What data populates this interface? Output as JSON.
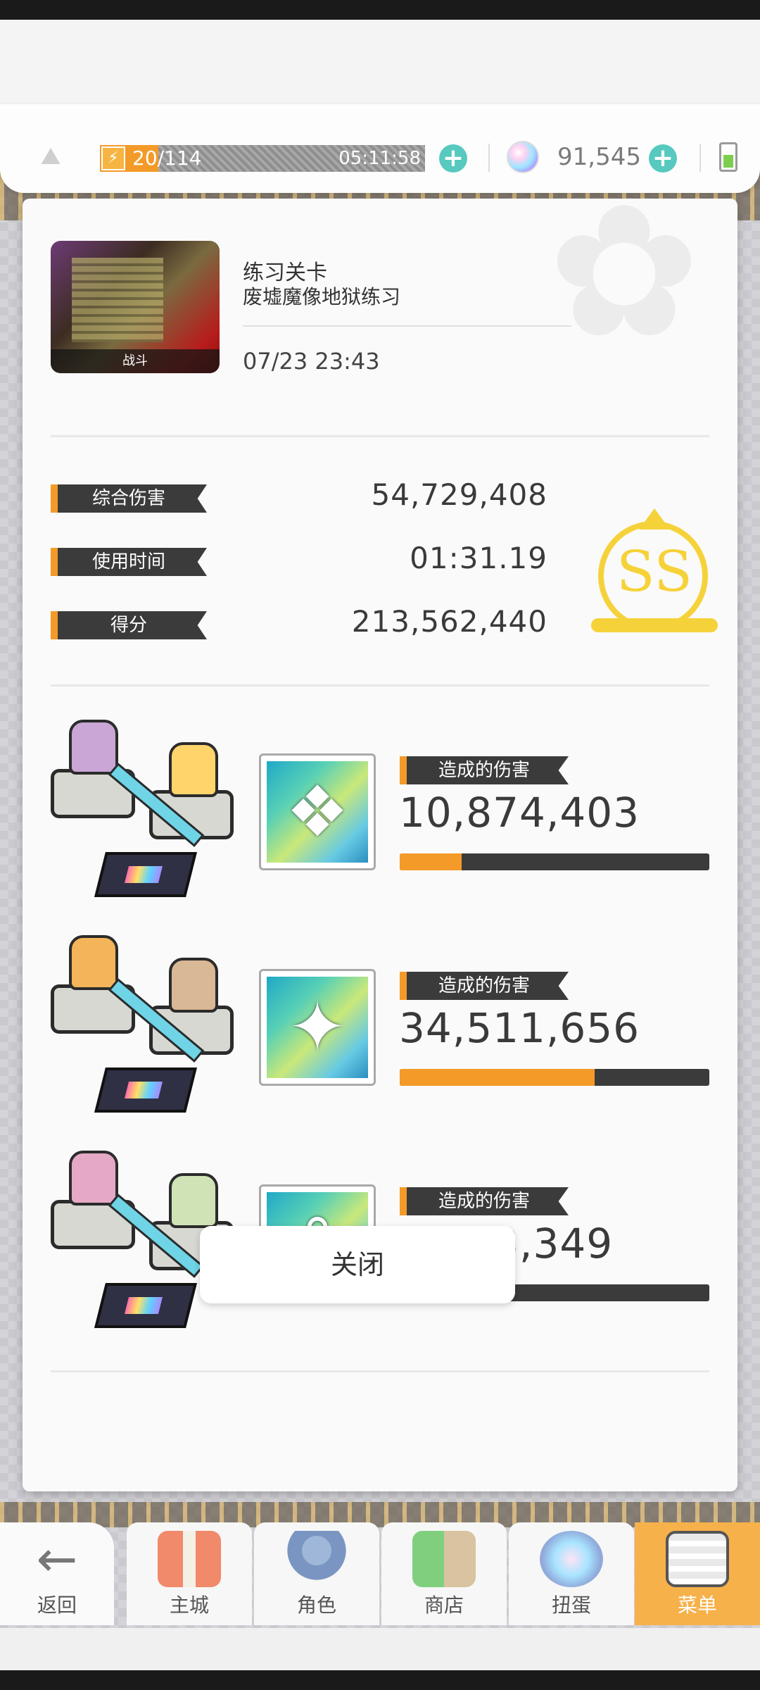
{
  "status_bar": {
    "energy_text": "20/114",
    "energy_timer": "05:11:58",
    "energy_fraction": 0.18,
    "gems": "91,545"
  },
  "result": {
    "thumbnail_label": "战斗",
    "stage_type": "练习关卡",
    "stage_name": "废墟魔像地狱练习",
    "datetime": "07/23 23:43",
    "stats": [
      {
        "label": "综合伤害",
        "value": "54,729,408"
      },
      {
        "label": "使用时间",
        "value": "01:31.19"
      },
      {
        "label": "得分",
        "value": "213,562,440"
      }
    ],
    "rank": "SS",
    "party": [
      {
        "damage_label": "造成的伤害",
        "damage": "10,874,403",
        "share": 0.2,
        "weapon_icon": "staff-icon"
      },
      {
        "damage_label": "造成的伤害",
        "damage": "34,511,656",
        "share": 0.63,
        "weapon_icon": "mace-icon"
      },
      {
        "damage_label": "造成的伤害",
        "damage": "9,343,349",
        "share": 0.17,
        "weapon_icon": "bow-icon"
      }
    ],
    "close_label": "关闭"
  },
  "nav": {
    "items": [
      {
        "label": "返回",
        "icon": "back-arrow-icon"
      },
      {
        "label": "主城",
        "icon": "castle-icon"
      },
      {
        "label": "角色",
        "icon": "character-icon"
      },
      {
        "label": "商店",
        "icon": "shop-icon"
      },
      {
        "label": "扭蛋",
        "icon": "gacha-icon"
      },
      {
        "label": "菜单",
        "icon": "menu-icon"
      }
    ]
  },
  "colors": {
    "accent": "#f39a28",
    "rank": "#f6d23a",
    "tag_bg": "#3b3b3b",
    "plus": "#57c9bf"
  }
}
